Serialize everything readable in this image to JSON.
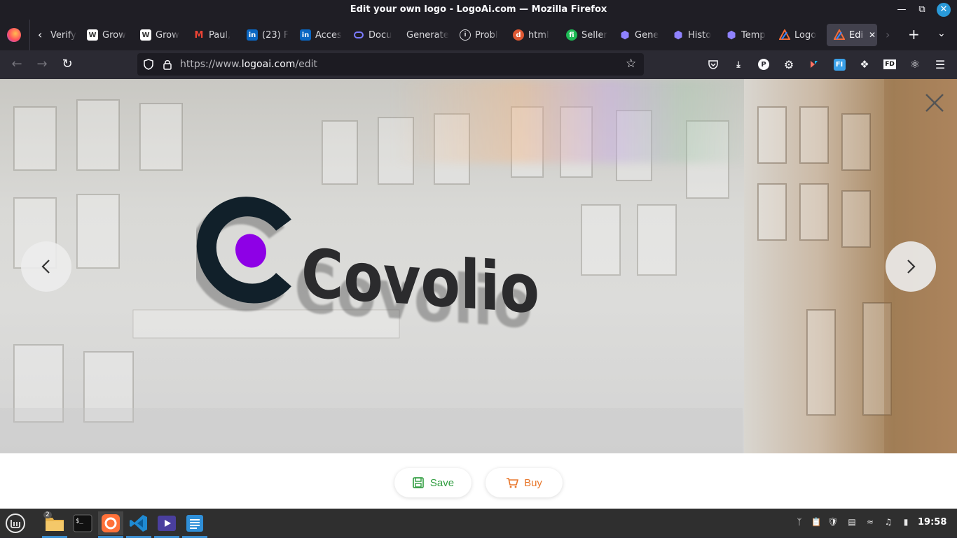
{
  "window": {
    "title": "Edit your own logo - LogoAi.com — Mozilla Firefox",
    "minimize_icon": "minimize-icon",
    "maximize_icon": "restore-icon",
    "close_icon": "close-icon"
  },
  "tabs": [
    {
      "label": "Verify",
      "icon": "page-icon",
      "color": "#888888"
    },
    {
      "label": "Grow",
      "icon": "webflow-icon",
      "color": "#ffffff"
    },
    {
      "label": "Grow",
      "icon": "webflow-icon",
      "color": "#ffffff"
    },
    {
      "label": "Paul,",
      "icon": "gmail-icon",
      "color": "#ea4335"
    },
    {
      "label": "(23) F",
      "icon": "linkedin-icon",
      "color": "#0a66c2"
    },
    {
      "label": "Acces",
      "icon": "linkedin-icon",
      "color": "#0a66c2"
    },
    {
      "label": "Docu",
      "icon": "docs-icon",
      "color": "#6b6bff"
    },
    {
      "label": "Generate",
      "icon": "",
      "color": ""
    },
    {
      "label": "Probl",
      "icon": "info-icon",
      "color": "#d8d8dc"
    },
    {
      "label": "html",
      "icon": "duckduckgo-icon",
      "color": "#de5833"
    },
    {
      "label": "Seller",
      "icon": "fi-icon",
      "color": "#1db954"
    },
    {
      "label": "Gene",
      "icon": "hex-icon",
      "color": "#7b6cf6"
    },
    {
      "label": "Histo",
      "icon": "hex-icon",
      "color": "#7b6cf6"
    },
    {
      "label": "Temp",
      "icon": "hex-icon",
      "color": "#7b6cf6"
    },
    {
      "label": "Logo",
      "icon": "logoai-icon",
      "color": "#f26b3a"
    },
    {
      "label": "Edi",
      "icon": "logoai-icon",
      "color": "#f26b3a",
      "active": true
    }
  ],
  "navbar": {
    "url_prefix": "https://www.",
    "url_host": "logoai.com",
    "url_path": "/edit"
  },
  "logo": {
    "brand_name": "Covolio",
    "mark_color": "#11202a",
    "dot_color": "#8e00e6"
  },
  "actions": {
    "save_label": "Save",
    "buy_label": "Buy",
    "save_color": "#2e9c3e",
    "buy_color": "#e8762a"
  },
  "taskbar": {
    "files_badge": "2",
    "clock": "19:58"
  }
}
